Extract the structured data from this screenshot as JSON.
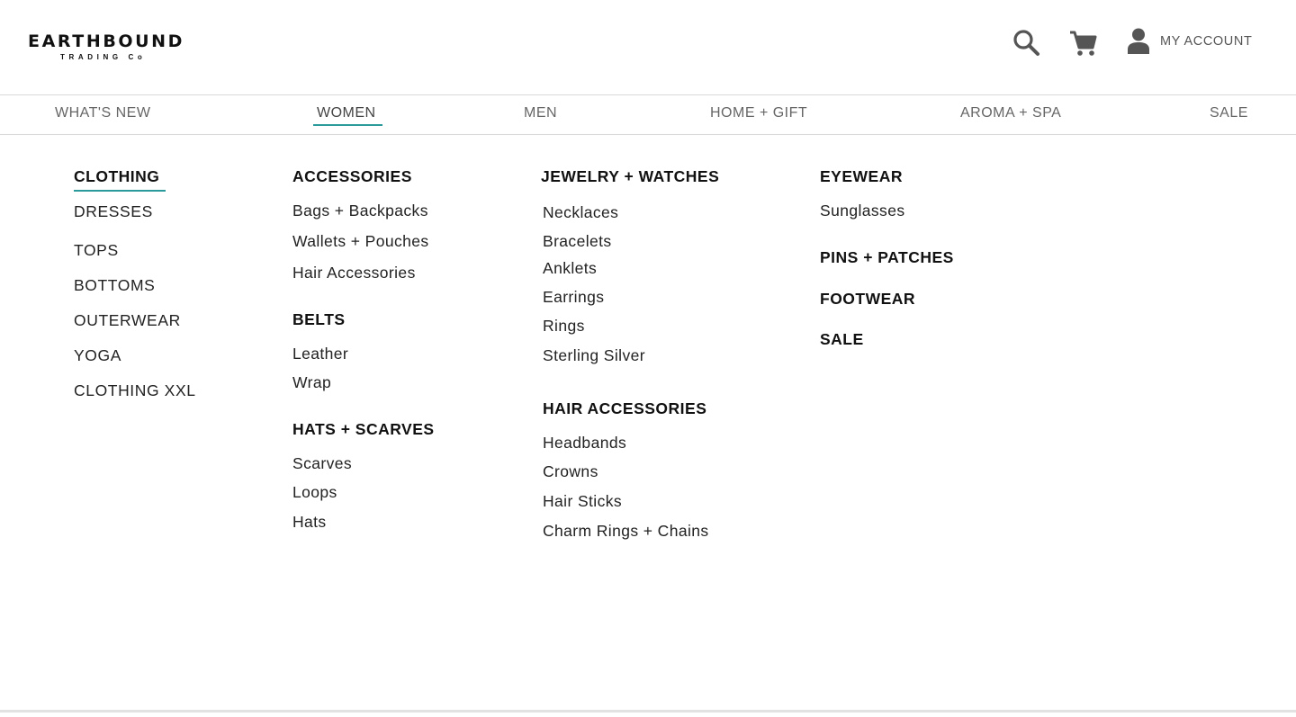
{
  "brand": {
    "name": "EARTHBOUND",
    "tagline": "TRADING Co"
  },
  "header": {
    "account_label": "MY ACCOUNT"
  },
  "nav": {
    "items": [
      "WHAT'S NEW",
      "WOMEN",
      "MEN",
      "HOME + GIFT",
      "AROMA + SPA",
      "SALE"
    ],
    "active": "WOMEN"
  },
  "colors": {
    "accent": "#2a9a9a",
    "icon": "#555555"
  },
  "icons": [
    "search-icon",
    "cart-icon",
    "user-icon"
  ],
  "mega": {
    "clothing": {
      "heading": "CLOTHING",
      "items": [
        "DRESSES",
        "TOPS",
        "BOTTOMS",
        "OUTERWEAR",
        "YOGA",
        "CLOTHING XXL"
      ]
    },
    "accessories": {
      "heading": "ACCESSORIES",
      "items": [
        "Bags + Backpacks",
        "Wallets + Pouches",
        "Hair Accessories"
      ]
    },
    "belts": {
      "heading": "BELTS",
      "items": [
        "Leather",
        "Wrap"
      ]
    },
    "hats": {
      "heading": "HATS + SCARVES",
      "items": [
        "Scarves",
        "Loops",
        "Hats"
      ]
    },
    "jewelry": {
      "heading": "JEWELRY + WATCHES",
      "items": [
        "Necklaces",
        "Bracelets",
        "Anklets",
        "Earrings",
        "Rings",
        "Sterling Silver"
      ]
    },
    "hair": {
      "heading": "HAIR ACCESSORIES",
      "items": [
        "Headbands",
        "Crowns",
        "Hair Sticks",
        "Charm Rings + Chains"
      ]
    },
    "eyewear": {
      "heading": "EYEWEAR",
      "items": [
        "Sunglasses"
      ]
    },
    "pins": {
      "heading": "PINS + PATCHES"
    },
    "footwear": {
      "heading": "FOOTWEAR"
    },
    "sale": {
      "heading": "SALE"
    }
  }
}
